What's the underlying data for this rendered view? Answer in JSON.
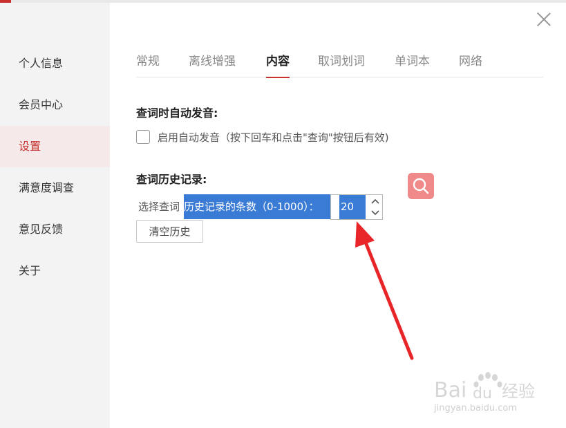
{
  "sidebar": {
    "items": [
      {
        "label": "个人信息"
      },
      {
        "label": "会员中心"
      },
      {
        "label": "设置"
      },
      {
        "label": "满意度调查"
      },
      {
        "label": "意见反馈"
      },
      {
        "label": "关于"
      }
    ],
    "active_index": 2
  },
  "tabs": [
    {
      "label": "常规"
    },
    {
      "label": "离线增强"
    },
    {
      "label": "内容"
    },
    {
      "label": "取词划词"
    },
    {
      "label": "单词本"
    },
    {
      "label": "网络"
    }
  ],
  "active_tab": "内容",
  "auto_pronounce": {
    "title": "查词时自动发音:",
    "checkbox_label": "启用自动发音（按下回车和点击\"查询\"按钮后有效)",
    "checked": false
  },
  "history": {
    "title": "查词历史记录:",
    "label_prefix": "选择查词",
    "label_selected": "历史记录的条数（0-1000）：",
    "count_value": "20",
    "clear_button": "清空历史"
  },
  "icons": {
    "close": "close-icon",
    "search_float": "search-icon",
    "stepper_up": "chevron-up-icon",
    "stepper_down": "chevron-down-icon",
    "arrow": "red-arrow-annotation",
    "watermark": "baidu-jingyan-watermark"
  },
  "watermark": {
    "brand_left": "Bai",
    "brand_right": "du",
    "brand_cn": "经验",
    "url": "jingyan.baidu.com"
  },
  "colors": {
    "accent_red": "#c9302c",
    "selection_blue": "#3a7bd5",
    "sidebar_bg": "#f3f3f3",
    "sidebar_active_bg": "#f6e9e9",
    "search_float_bg": "#f08a8a",
    "arrow_red": "#e8262a"
  }
}
